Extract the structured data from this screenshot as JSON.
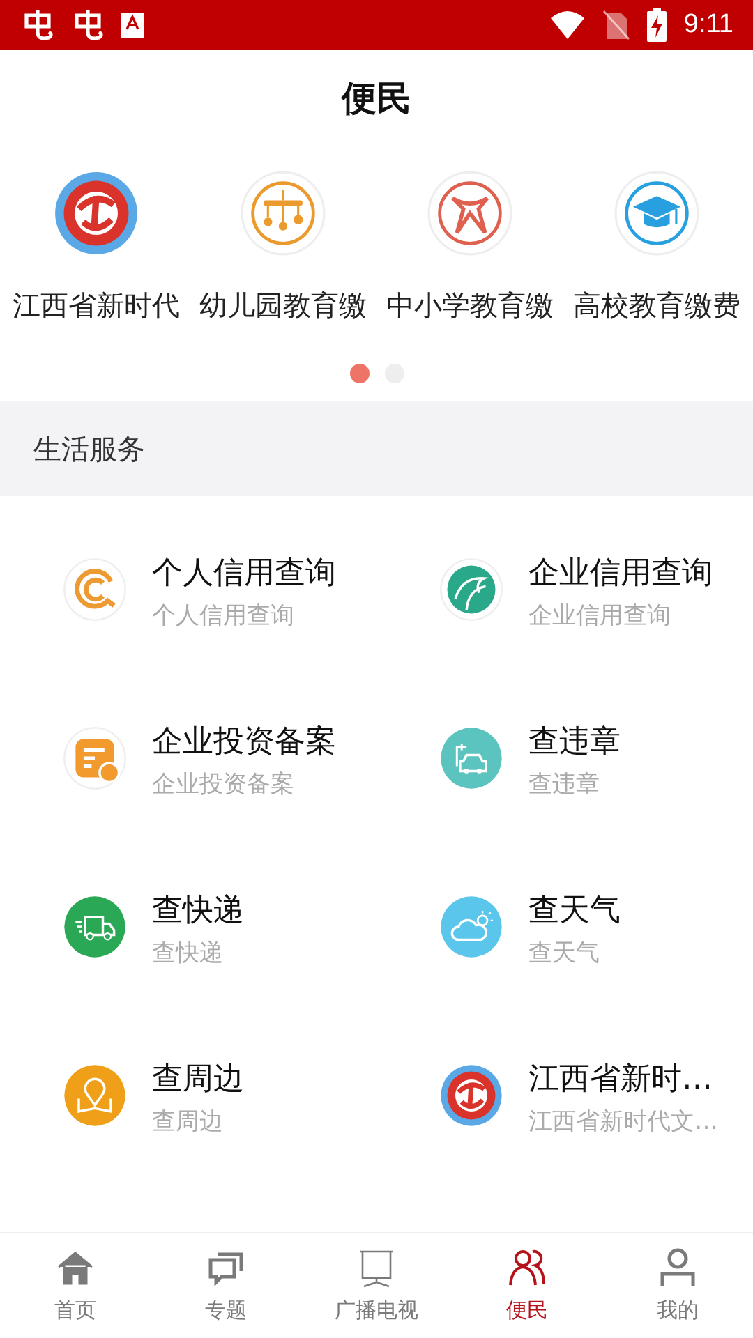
{
  "status_bar": {
    "time": "9:11"
  },
  "header": {
    "title": "便民"
  },
  "shortcuts": [
    {
      "label": "江西省新时代",
      "kind": "emblem"
    },
    {
      "label": "幼儿园教育缴",
      "kind": "mobile"
    },
    {
      "label": "中小学教育缴",
      "kind": "scarf"
    },
    {
      "label": "高校教育缴费",
      "kind": "cap"
    }
  ],
  "pager": [
    {
      "selected": true
    },
    {
      "selected": false
    }
  ],
  "section": {
    "title": "生活服务"
  },
  "services": [
    {
      "title": "个人信用查询",
      "subtitle": "个人信用查询",
      "kind": "credit"
    },
    {
      "title": "企业信用查询",
      "subtitle": "企业信用查询",
      "kind": "wave"
    },
    {
      "title": "企业投资备案",
      "subtitle": "企业投资备案",
      "kind": "doc"
    },
    {
      "title": "查违章",
      "subtitle": "查违章",
      "kind": "car"
    },
    {
      "title": "查快递",
      "subtitle": "查快递",
      "kind": "truck"
    },
    {
      "title": "查天气",
      "subtitle": "查天气",
      "kind": "weather"
    },
    {
      "title": "查周边",
      "subtitle": "查周边",
      "kind": "map"
    },
    {
      "title": "江西省新时…",
      "subtitle": "江西省新时代文…",
      "kind": "emblem"
    }
  ],
  "tab_bar": [
    {
      "label": "首页",
      "kind": "home",
      "selected": false
    },
    {
      "label": "专题",
      "kind": "chat",
      "selected": false
    },
    {
      "label": "广播电视",
      "kind": "screen",
      "selected": false
    },
    {
      "label": "便民",
      "kind": "people",
      "selected": true
    },
    {
      "label": "我的",
      "kind": "person",
      "selected": false
    }
  ]
}
